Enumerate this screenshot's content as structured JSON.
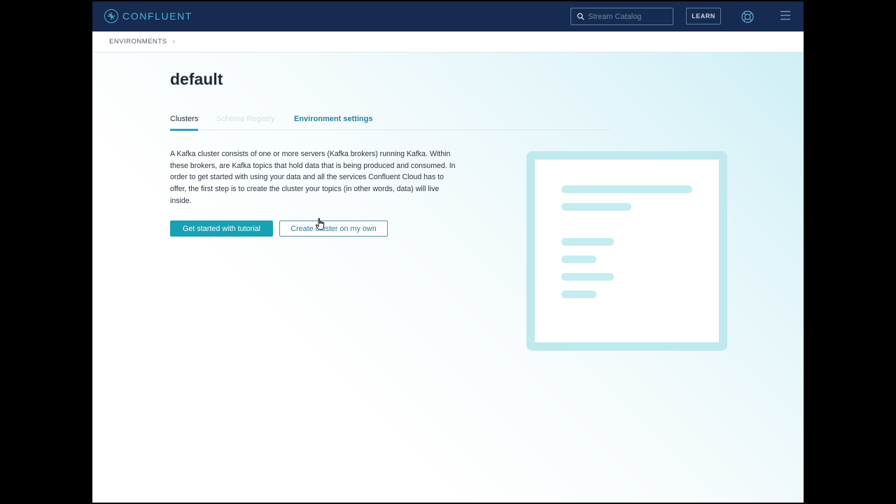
{
  "header": {
    "brand": "CONFLUENT",
    "search_placeholder": "Stream Catalog",
    "learn_label": "LEARN"
  },
  "breadcrumb": {
    "items": [
      "ENVIRONMENTS"
    ]
  },
  "main": {
    "title": "default",
    "tabs": [
      {
        "label": "Clusters",
        "state": "active"
      },
      {
        "label": "Schema Registry",
        "state": "disabled"
      },
      {
        "label": "Environment settings",
        "state": "link"
      }
    ],
    "description": "A Kafka cluster consists of one or more servers (Kafka brokers) running Kafka. Within these brokers, are Kafka topics that hold data that is being produced and consumed. In order to get started with using your data and all the services Confluent Cloud has to offer, the first step is to create the cluster your topics (in other words, data) will live inside.",
    "primary_button": "Get started with tutorial",
    "secondary_button": "Create cluster on my own"
  },
  "icons": {
    "brand": "confluent-logo-icon",
    "search": "search-icon",
    "help": "lifebuoy-icon",
    "menu": "hamburger-menu-icon",
    "cursor": "hand-pointer-icon"
  },
  "colors": {
    "nav_bg": "#172a4f",
    "brand": "#48b4d6",
    "primary": "#18a0b3",
    "link": "#2a7e9c"
  }
}
